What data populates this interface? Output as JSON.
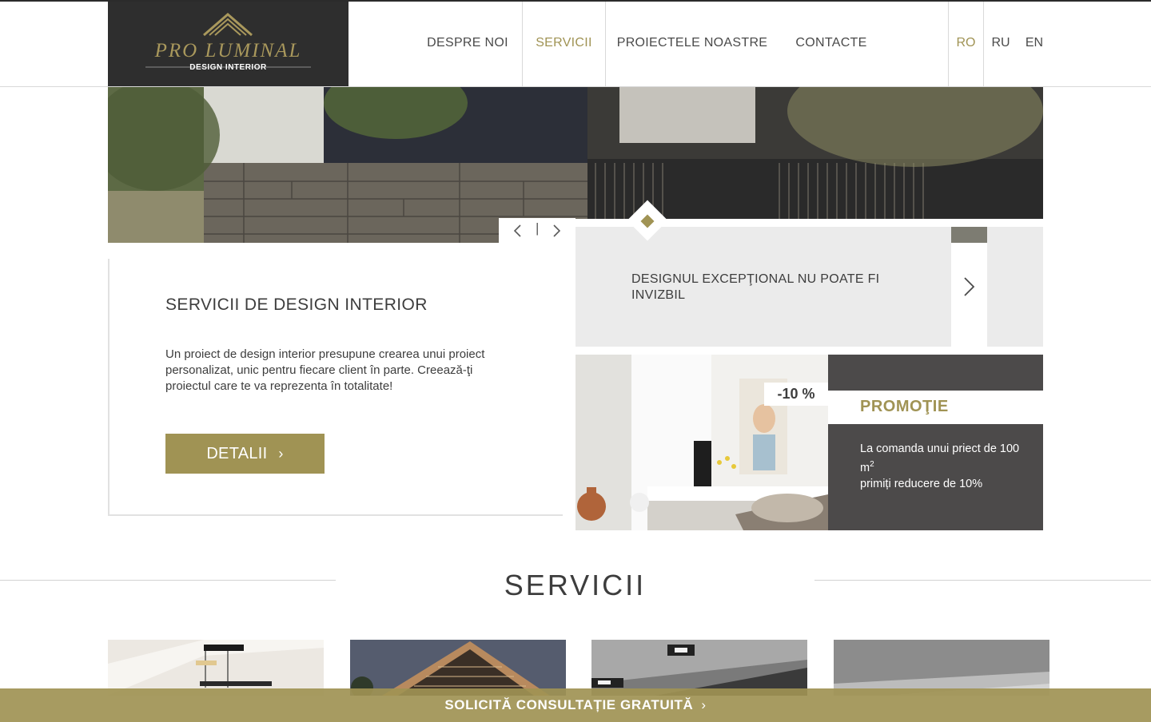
{
  "header": {
    "logo_title": "PRO LUMINAL",
    "logo_subtitle": "DESIGN INTERIOR",
    "nav": [
      {
        "label": "DESPRE NOI"
      },
      {
        "label": "SERVICII"
      },
      {
        "label": "PROIECTELE NOASTRE"
      },
      {
        "label": "CONTACTE"
      }
    ],
    "languages": [
      "RO",
      "RU",
      "EN"
    ],
    "active_nav": "SERVICII",
    "active_language": "RO"
  },
  "slider": {
    "prev_icon": "chevron-left-icon",
    "divider": "|",
    "next_icon": "chevron-right-icon"
  },
  "intro": {
    "title": "SERVICII DE DESIGN INTERIOR",
    "text": "Un proiect de design interior presupune crearea unui proiect personalizat, unic pentru fiecare client în parte. Creează-ţi proiectul care te va reprezenta în totalitate!",
    "button_label": "DETALII",
    "button_icon": "›"
  },
  "quote": {
    "text": "DESIGNUL EXCEPŢIONAL NU POATE FI INVIZBIL"
  },
  "promo": {
    "badge": "-10 %",
    "title": "PROMOŢIE",
    "line1": "La comanda unui priect de 100 m",
    "superscript": "2",
    "line2": "primiți reducere de 10%"
  },
  "services": {
    "title": "SERVICII"
  },
  "cta": {
    "label": "SOLICITĂ CONSULTAȚIE GRATUITĂ",
    "icon": "›"
  },
  "colors": {
    "accent": "#a09354",
    "dark": "#2e2e2e",
    "promo_dark": "#4c4a4a",
    "panel_gray": "#ebebeb"
  }
}
